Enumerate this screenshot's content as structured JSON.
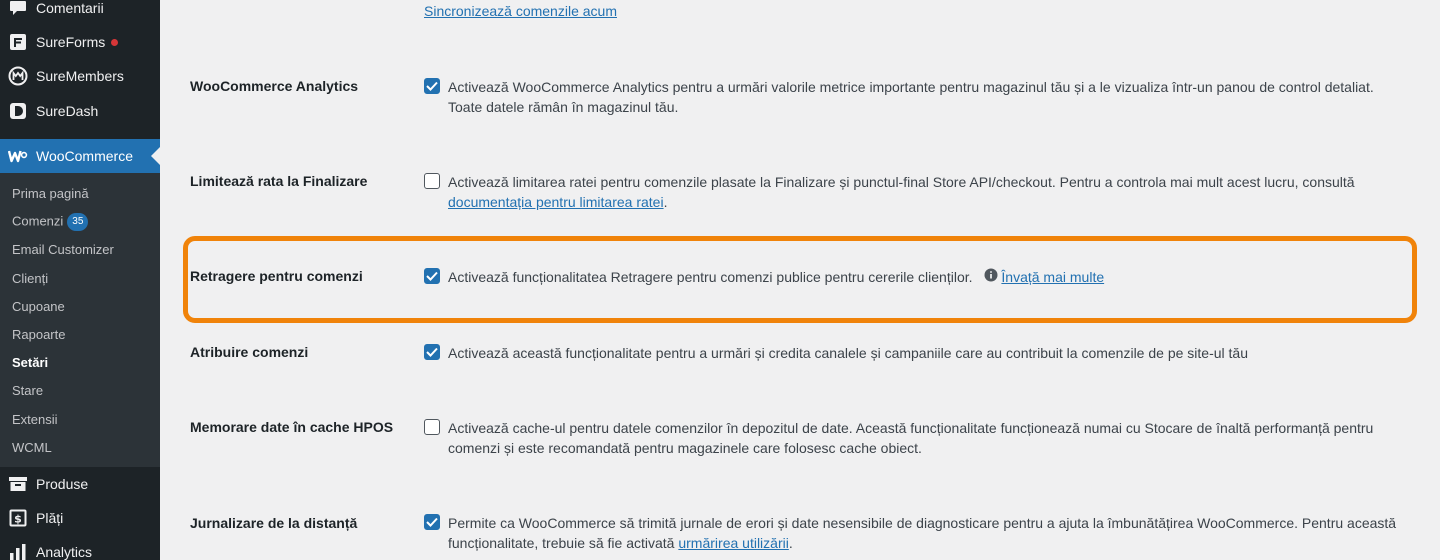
{
  "sidebar": {
    "top_items": [
      {
        "label": "Comentarii",
        "icon": "comment-icon"
      },
      {
        "label": "SureForms",
        "icon": "sureforms-icon",
        "has_dot": true
      },
      {
        "label": "SureMembers",
        "icon": "suremembers-icon"
      },
      {
        "label": "SureDash",
        "icon": "suredash-icon"
      }
    ],
    "active": {
      "label": "WooCommerce",
      "icon": "woocommerce-icon"
    },
    "submenu": [
      {
        "label": "Prima pagină"
      },
      {
        "label": "Comenzi",
        "badge": "35"
      },
      {
        "label": "Email Customizer"
      },
      {
        "label": "Clienți"
      },
      {
        "label": "Cupoane"
      },
      {
        "label": "Rapoarte"
      },
      {
        "label": "Setări",
        "current": true
      },
      {
        "label": "Stare"
      },
      {
        "label": "Extensii"
      },
      {
        "label": "WCML"
      }
    ],
    "bottom_items": [
      {
        "label": "Produse",
        "icon": "products-icon"
      },
      {
        "label": "Plăți",
        "icon": "payments-icon"
      },
      {
        "label": "Analytics",
        "icon": "analytics-icon"
      }
    ]
  },
  "main": {
    "sync_link": "Sincronizează comenzile acum",
    "rows": [
      {
        "label": "WooCommerce Analytics",
        "checked": true,
        "text": "Activează WooCommerce Analytics pentru a urmări valorile metrice importante pentru magazinul tău și a le vizualiza într-un panou de control detaliat. Toate datele rămân în magazinul tău."
      },
      {
        "label": "Limitează rata la Finalizare",
        "checked": false,
        "text": "Activează limitarea ratei pentru comenzile plasate la Finalizare și punctul-final Store API/checkout. Pentru a controla mai mult acest lucru, consultă",
        "link": "documentația pentru limitarea ratei",
        "after": "."
      },
      {
        "label": "Retragere pentru comenzi",
        "checked": true,
        "text": "Activează funcționalitatea Retragere pentru comenzi publice pentru cererile clienților.",
        "link": "Învață mai multe",
        "highlighted": true
      },
      {
        "label": "Atribuire comenzi",
        "checked": true,
        "text": "Activează această funcționalitate pentru a urmări și credita canalele și campaniile care au contribuit la comenzile de pe site-ul tău"
      },
      {
        "label": "Memorare date în cache HPOS",
        "checked": false,
        "text": "Activează cache-ul pentru datele comenzilor în depozitul de date. Această funcționalitate funcționează numai cu Stocare de înaltă performanță pentru comenzi și este recomandată pentru magazinele care folosesc cache obiect."
      },
      {
        "label": "Jurnalizare de la distanță",
        "checked": true,
        "text": "Permite ca WooCommerce să trimită jurnale de erori și date nesensibile de diagnosticare pentru a ajuta la îmbunătățirea WooCommerce. Pentru această funcționalitate, trebuie să fie activată",
        "link": "urmărirea utilizării",
        "after": "."
      }
    ]
  },
  "colors": {
    "sidebar_bg": "#1d2327",
    "submenu_bg": "#2c3338",
    "accent": "#2271b1",
    "highlight": "#f0830a",
    "notification_dot": "#d63638"
  }
}
